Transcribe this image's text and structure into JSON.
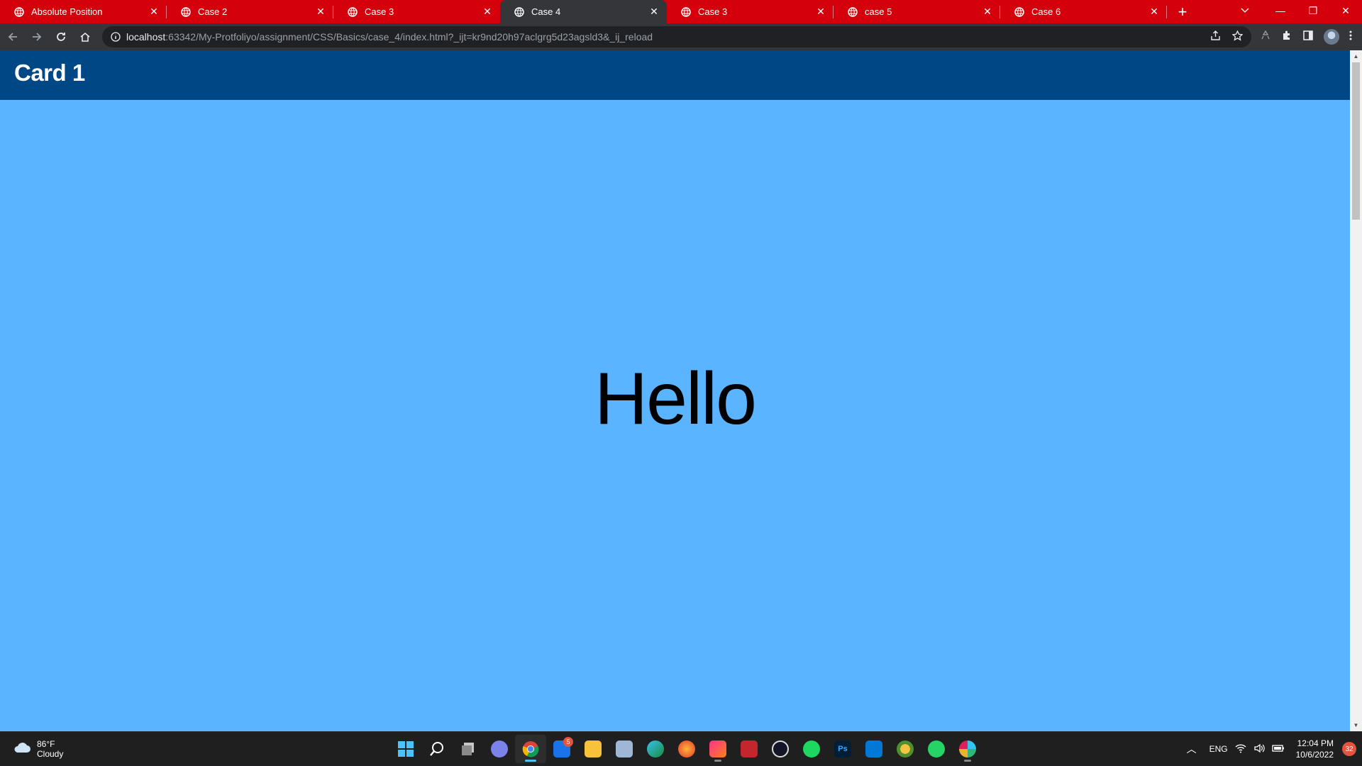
{
  "browser": {
    "tabs": [
      {
        "title": "Absolute Position",
        "active": false
      },
      {
        "title": "Case 2",
        "active": false
      },
      {
        "title": "Case 3",
        "active": false
      },
      {
        "title": "Case 4",
        "active": true
      },
      {
        "title": "Case 3",
        "active": false
      },
      {
        "title": "case 5",
        "active": false
      },
      {
        "title": "Case 6",
        "active": false
      }
    ],
    "address": {
      "host": "localhost",
      "path": ":63342/My-Protfoliyo/assignment/CSS/Basics/case_4/index.html?_ijt=kr9nd20h97aclgrg5d23agsld3&_ij_reload"
    }
  },
  "page": {
    "header_title": "Card 1",
    "body_text": "Hello",
    "header_color": "#004786",
    "background_color": "#5ab4ff"
  },
  "taskbar": {
    "weather": {
      "temp": "86°F",
      "condition": "Cloudy"
    },
    "mail_badge": "5",
    "language": "ENG",
    "time": "12:04 PM",
    "date": "10/6/2022",
    "notifications": "32"
  }
}
